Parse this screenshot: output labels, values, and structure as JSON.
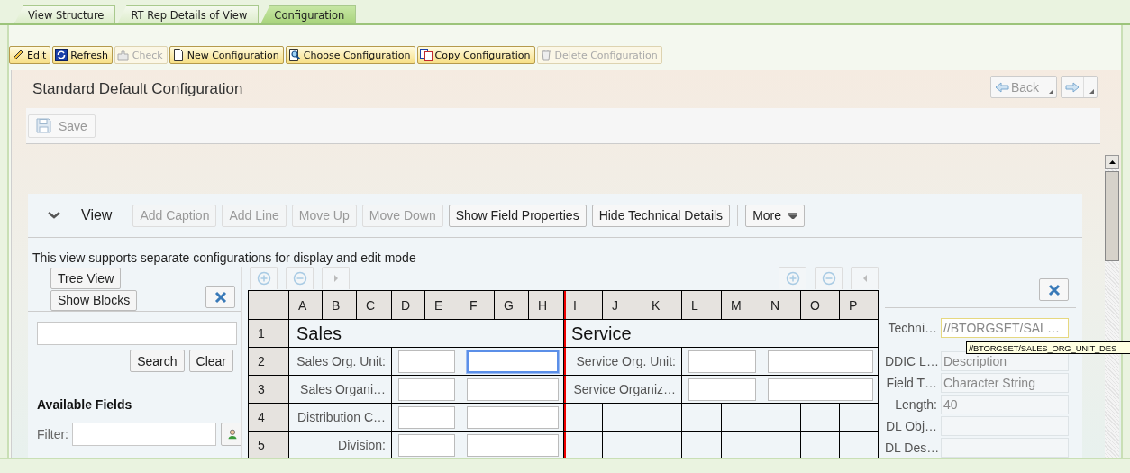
{
  "tabs": [
    {
      "label": "View Structure",
      "selected": false
    },
    {
      "label": "RT Rep Details of View",
      "selected": false
    },
    {
      "label": "Configuration",
      "selected": true
    }
  ],
  "toolbar": [
    {
      "kind": "edit",
      "label": "Edit",
      "disabled": false
    },
    {
      "kind": "refresh",
      "label": "Refresh",
      "disabled": false
    },
    {
      "kind": "check",
      "label": "Check",
      "disabled": true
    },
    {
      "kind": "new",
      "label": "New Configuration",
      "disabled": false
    },
    {
      "kind": "choose",
      "label": "Choose Configuration",
      "disabled": false
    },
    {
      "kind": "copy",
      "label": "Copy Configuration",
      "disabled": false
    },
    {
      "kind": "delete",
      "label": "Delete Configuration",
      "disabled": true
    }
  ],
  "page": {
    "title": "Standard Default Configuration",
    "back": {
      "label": "Back",
      "disabled": true
    },
    "save": {
      "label": "Save",
      "disabled": true
    }
  },
  "view": {
    "title": "View",
    "expanded": true,
    "buttons": [
      {
        "kind": "plain",
        "label": "Add Caption",
        "disabled": true
      },
      {
        "kind": "plain",
        "label": "Add Line",
        "disabled": true
      },
      {
        "kind": "plain",
        "label": "Move Up",
        "disabled": true
      },
      {
        "kind": "plain",
        "label": "Move Down",
        "disabled": true
      },
      {
        "kind": "plain",
        "label": "Show Field Properties",
        "disabled": false
      },
      {
        "kind": "plain",
        "label": "Hide Technical Details",
        "disabled": false
      },
      {
        "kind": "menu",
        "label": "More",
        "disabled": false
      }
    ],
    "note": "This view supports separate configurations for display and edit mode"
  },
  "fields_pane": {
    "buttons": [
      "Tree View",
      "Show Blocks"
    ],
    "search_buttons": [
      "Search",
      "Clear"
    ],
    "heading": "Available Fields",
    "filter_label": "Filter:"
  },
  "grid": {
    "columns": [
      "",
      "A",
      "B",
      "C",
      "D",
      "E",
      "F",
      "G",
      "H",
      "I",
      "J",
      "K",
      "L",
      "M",
      "N",
      "O",
      "P"
    ],
    "rows": [
      {
        "cells": [
          {
            "kind": "number",
            "text": "1"
          },
          {
            "kind": "title",
            "text": "Sales",
            "colspan": 8
          },
          {
            "kind": "title",
            "text": "Service",
            "colspan": 8
          }
        ]
      },
      {
        "cells": [
          {
            "kind": "number",
            "text": "2"
          },
          {
            "kind": "label",
            "text": "Sales Org. Unit:",
            "colspan": 3
          },
          {
            "kind": "field",
            "selected": false,
            "colspan": 2
          },
          {
            "kind": "field",
            "selected": true,
            "colspan": 3
          },
          {
            "kind": "label",
            "text": "Service Org. Unit:",
            "colspan": 3
          },
          {
            "kind": "field",
            "selected": false,
            "colspan": 2
          },
          {
            "kind": "field",
            "selected": false,
            "colspan": 3
          }
        ]
      },
      {
        "cells": [
          {
            "kind": "number",
            "text": "3"
          },
          {
            "kind": "label",
            "text": "Sales Organi…",
            "colspan": 3
          },
          {
            "kind": "field",
            "selected": false,
            "colspan": 2
          },
          {
            "kind": "field",
            "selected": false,
            "colspan": 3
          },
          {
            "kind": "label",
            "text": "Service Organiz…",
            "colspan": 3
          },
          {
            "kind": "field",
            "selected": false,
            "colspan": 2
          },
          {
            "kind": "field",
            "selected": false,
            "colspan": 3
          }
        ]
      },
      {
        "cells": [
          {
            "kind": "number",
            "text": "4"
          },
          {
            "kind": "label",
            "text": "Distribution C…",
            "colspan": 3
          },
          {
            "kind": "field",
            "selected": false,
            "colspan": 2
          },
          {
            "kind": "field",
            "selected": false,
            "colspan": 3
          },
          {
            "kind": "empty"
          },
          {
            "kind": "empty"
          },
          {
            "kind": "empty"
          },
          {
            "kind": "empty"
          },
          {
            "kind": "empty"
          },
          {
            "kind": "empty"
          },
          {
            "kind": "empty"
          },
          {
            "kind": "empty"
          }
        ]
      },
      {
        "cells": [
          {
            "kind": "number",
            "text": "5"
          },
          {
            "kind": "label",
            "text": "Division:",
            "colspan": 3
          },
          {
            "kind": "field",
            "selected": false,
            "colspan": 2
          },
          {
            "kind": "field",
            "selected": false,
            "colspan": 3
          },
          {
            "kind": "empty"
          },
          {
            "kind": "empty"
          },
          {
            "kind": "empty"
          },
          {
            "kind": "empty"
          },
          {
            "kind": "empty"
          },
          {
            "kind": "empty"
          },
          {
            "kind": "empty"
          },
          {
            "kind": "empty"
          }
        ]
      }
    ]
  },
  "details": {
    "rows": [
      {
        "label": "Techni…",
        "value": "//BTORGSET/SAL…",
        "highlighted": true
      },
      {
        "label": "DDIC L…",
        "value": "Description",
        "highlighted": false
      },
      {
        "label": "Field T…",
        "value": "Character String",
        "highlighted": false
      },
      {
        "label": "Length:",
        "value": "40",
        "highlighted": false
      },
      {
        "label": "DL Obj…",
        "highlighted": false
      },
      {
        "label": "DL Des…",
        "highlighted": false
      }
    ],
    "tooltip": "//BTORGSET/SALES_ORG_UNIT_DES"
  }
}
